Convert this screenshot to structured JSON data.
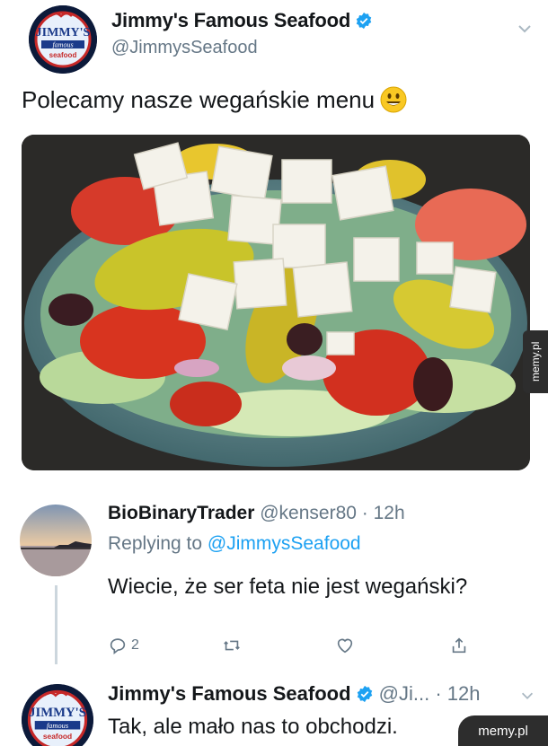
{
  "tweet": {
    "author_name": "Jimmy's Famous Seafood",
    "handle": "@JimmysSeafood",
    "text": "Polecamy nasze wegańskie menu",
    "emoji": "smiley-emoji",
    "logo_text": "JIMMY'S famous seafood",
    "photo": "greek-salad-bowl"
  },
  "reply": {
    "author_name": "BioBinaryTrader",
    "handle_time": "@kenser80 · 12h",
    "replying_prefix": "Replying to",
    "replying_to": "@JimmysSeafood",
    "text": "Wiecie, że ser feta nie jest wegański?",
    "reply_count": "2"
  },
  "reply2": {
    "author_name": "Jimmy's Famous Seafood",
    "handle_time": "@Ji... · 12h",
    "text": "Tak, ale mało nas to obchodzi."
  },
  "watermark": {
    "side": "memy.pl",
    "bottom": "memy.pl"
  },
  "colors": {
    "verified": "#1da1f2",
    "link": "#1da1f2",
    "muted": "#657786"
  }
}
